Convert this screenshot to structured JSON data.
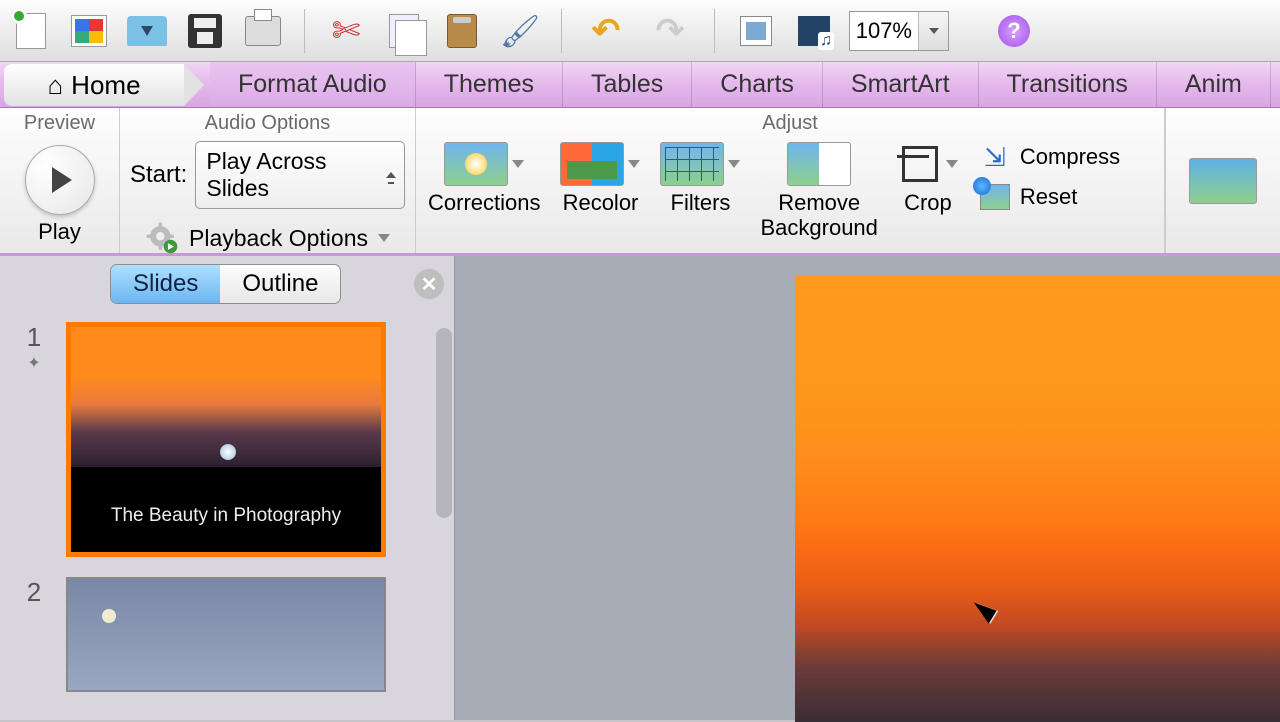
{
  "toolbar": {
    "zoom": "107%"
  },
  "tabs": {
    "home": "Home",
    "format_audio": "Format Audio",
    "themes": "Themes",
    "tables": "Tables",
    "charts": "Charts",
    "smartart": "SmartArt",
    "transitions": "Transitions",
    "animations_partial": "Anim"
  },
  "ribbon": {
    "preview_title": "Preview",
    "play": "Play",
    "audio_options_title": "Audio Options",
    "start_label": "Start:",
    "start_value": "Play Across Slides",
    "playback_options": "Playback Options",
    "adjust_title": "Adjust",
    "corrections": "Corrections",
    "recolor": "Recolor",
    "filters": "Filters",
    "remove_background": "Remove\nBackground",
    "crop": "Crop",
    "compress": "Compress",
    "reset": "Reset"
  },
  "side": {
    "slides_tab": "Slides",
    "outline_tab": "Outline",
    "slide1_num": "1",
    "slide1_title": "The Beauty in Photography",
    "slide2_num": "2"
  }
}
